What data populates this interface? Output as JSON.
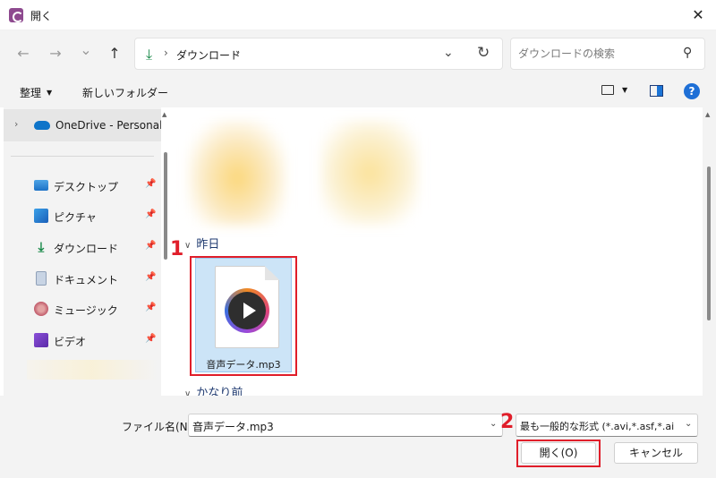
{
  "window": {
    "title": "開く",
    "close_glyph": "✕"
  },
  "nav": {
    "back_glyph": "←",
    "forward_glyph": "→",
    "recent_glyph": "⌄",
    "up_glyph": "↑",
    "address": {
      "path_label": "ダウンロード",
      "separator": "›"
    },
    "search": {
      "placeholder": "ダウンロードの検索"
    }
  },
  "toolbar": {
    "organize_label": "整理",
    "new_folder_label": "新しいフォルダー",
    "help_glyph": "?"
  },
  "sidebar": {
    "onedrive_label": "OneDrive - Personal",
    "items": [
      {
        "label": "デスクトップ",
        "icon": "desktop-icon"
      },
      {
        "label": "ピクチャ",
        "icon": "pictures-icon"
      },
      {
        "label": "ダウンロード",
        "icon": "download-icon"
      },
      {
        "label": "ドキュメント",
        "icon": "documents-icon"
      },
      {
        "label": "ミュージック",
        "icon": "music-icon"
      },
      {
        "label": "ビデオ",
        "icon": "video-icon"
      }
    ]
  },
  "content": {
    "groups": [
      {
        "label": "昨日"
      },
      {
        "label": "かなり前"
      }
    ],
    "file": {
      "name": "音声データ.mp3",
      "icon": "audio-file-icon"
    }
  },
  "annotations": {
    "step1": "1",
    "step2": "2",
    "color": "#e01e2a"
  },
  "footer": {
    "filename_label": "ファイル名(N):",
    "filename_value": "音声データ.mp3",
    "filetype_value": "最も一般的な形式 (*.avi,*.asf,*.ai",
    "open_label": "開く(O)",
    "cancel_label": "キャンセル"
  }
}
